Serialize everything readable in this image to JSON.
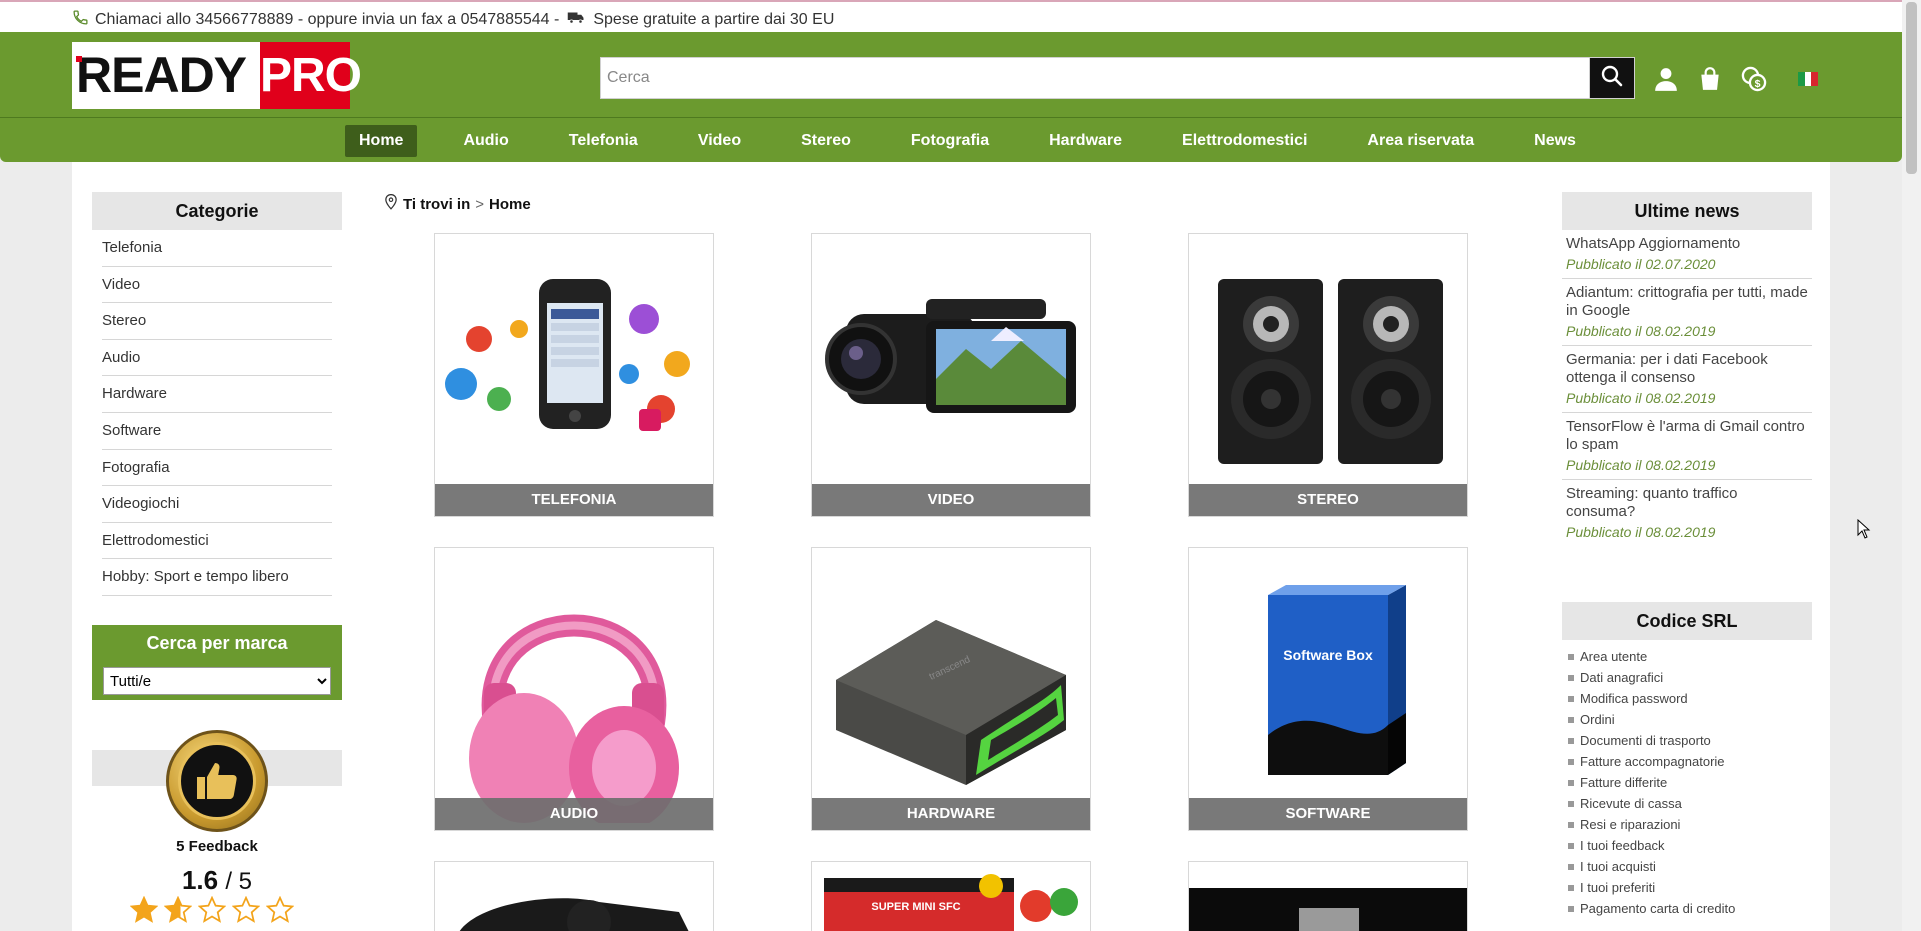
{
  "topbar": {
    "text": "Chiamaci allo 34566778889 - oppure invia un fax a 0547885544 -",
    "shipping": "Spese gratuite a partire dai 30 EU"
  },
  "logo": {
    "ready": "READY",
    "pro": "PRO"
  },
  "search": {
    "placeholder": "Cerca"
  },
  "nav": {
    "items": [
      "Home",
      "Audio",
      "Telefonia",
      "Video",
      "Stereo",
      "Fotografia",
      "Hardware",
      "Elettrodomestici",
      "Area riservata",
      "News"
    ],
    "active": "Home"
  },
  "categories": {
    "title": "Categorie",
    "items": [
      "Telefonia",
      "Video",
      "Stereo",
      "Audio",
      "Hardware",
      "Software",
      "Fotografia",
      "Videogiochi",
      "Elettrodomestici",
      "Hobby: Sport e tempo libero"
    ]
  },
  "brand": {
    "title": "Cerca per marca",
    "selected": "Tutti/e"
  },
  "feedback": {
    "count": "5 Feedback",
    "score": "1.6",
    "max": "/ 5",
    "stars": 1.6
  },
  "breadcrumb": {
    "prefix": "Ti trovi in",
    "sep": ">",
    "current": "Home"
  },
  "cards": [
    "TELEFONIA",
    "VIDEO",
    "STEREO",
    "AUDIO",
    "HARDWARE",
    "SOFTWARE"
  ],
  "software_box": "Software Box",
  "news": {
    "title": "Ultime news",
    "items": [
      {
        "title": "WhatsApp Aggiornamento",
        "date": "Pubblicato il 02.07.2020"
      },
      {
        "title": "Adiantum: crittografia per tutti, made in Google",
        "date": "Pubblicato il 08.02.2019"
      },
      {
        "title": "Germania: per i dati Facebook ottenga il consenso",
        "date": "Pubblicato il 08.02.2019"
      },
      {
        "title": "TensorFlow è l'arma di Gmail contro lo spam",
        "date": "Pubblicato il 08.02.2019"
      },
      {
        "title": "Streaming: quanto traffico consuma?",
        "date": "Pubblicato il 08.02.2019"
      }
    ]
  },
  "codice": {
    "title": "Codice SRL",
    "links": [
      "Area utente",
      "Dati anagrafici",
      "Modifica password",
      "Ordini",
      "Documenti di trasporto",
      "Fatture accompagnatorie",
      "Fatture differite",
      "Ricevute di cassa",
      "Resi e riparazioni",
      "I tuoi feedback",
      "I tuoi acquisti",
      "I tuoi preferiti",
      "Pagamento carta di credito"
    ]
  },
  "colors": {
    "brand_green": "#6b9a2f",
    "nav_active": "#3e5e1b",
    "logo_red": "#e0001b",
    "date_green": "#6b8f3a"
  },
  "icons": [
    "phone-icon",
    "truck-icon",
    "search-icon",
    "user-icon",
    "cart-icon",
    "currency-icon",
    "italy-flag-icon",
    "location-pin-icon",
    "thumbs-up-medal-icon",
    "star-icon"
  ]
}
